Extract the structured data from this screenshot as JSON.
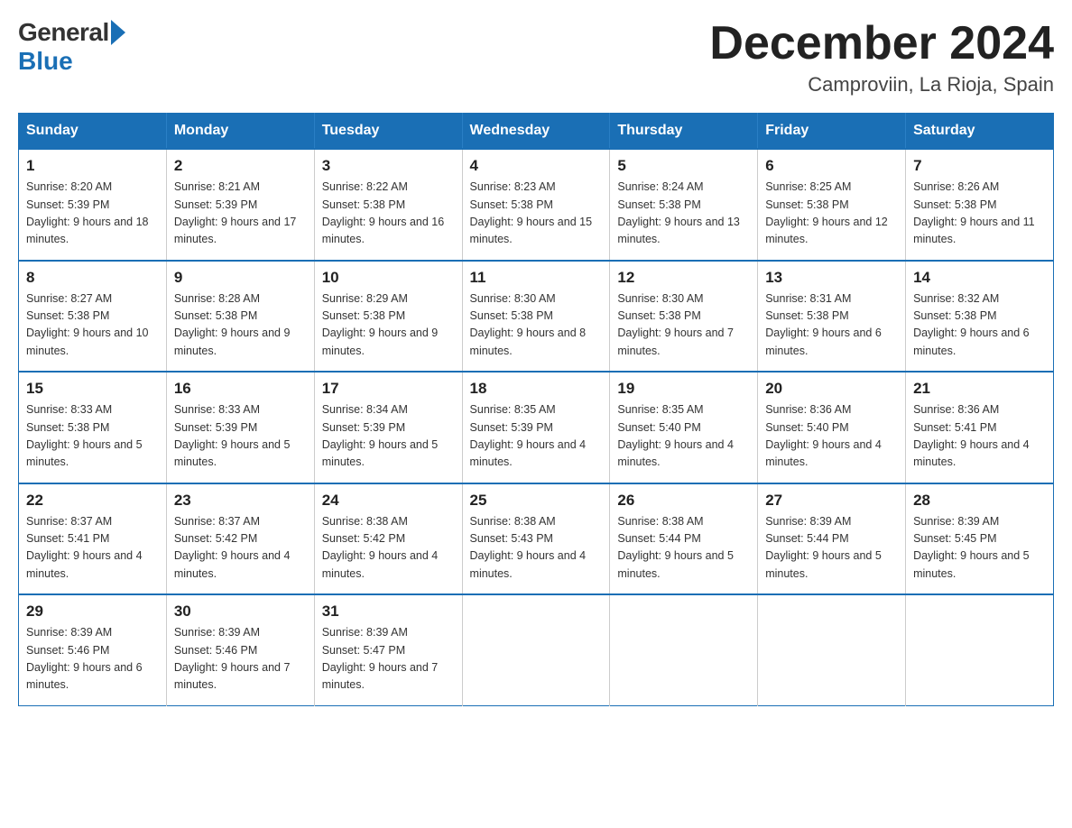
{
  "header": {
    "logo_general": "General",
    "logo_blue": "Blue",
    "month_year": "December 2024",
    "location": "Camproviin, La Rioja, Spain"
  },
  "calendar": {
    "days_of_week": [
      "Sunday",
      "Monday",
      "Tuesday",
      "Wednesday",
      "Thursday",
      "Friday",
      "Saturday"
    ],
    "weeks": [
      [
        {
          "day": "1",
          "sunrise": "8:20 AM",
          "sunset": "5:39 PM",
          "daylight": "9 hours and 18 minutes."
        },
        {
          "day": "2",
          "sunrise": "8:21 AM",
          "sunset": "5:39 PM",
          "daylight": "9 hours and 17 minutes."
        },
        {
          "day": "3",
          "sunrise": "8:22 AM",
          "sunset": "5:38 PM",
          "daylight": "9 hours and 16 minutes."
        },
        {
          "day": "4",
          "sunrise": "8:23 AM",
          "sunset": "5:38 PM",
          "daylight": "9 hours and 15 minutes."
        },
        {
          "day": "5",
          "sunrise": "8:24 AM",
          "sunset": "5:38 PM",
          "daylight": "9 hours and 13 minutes."
        },
        {
          "day": "6",
          "sunrise": "8:25 AM",
          "sunset": "5:38 PM",
          "daylight": "9 hours and 12 minutes."
        },
        {
          "day": "7",
          "sunrise": "8:26 AM",
          "sunset": "5:38 PM",
          "daylight": "9 hours and 11 minutes."
        }
      ],
      [
        {
          "day": "8",
          "sunrise": "8:27 AM",
          "sunset": "5:38 PM",
          "daylight": "9 hours and 10 minutes."
        },
        {
          "day": "9",
          "sunrise": "8:28 AM",
          "sunset": "5:38 PM",
          "daylight": "9 hours and 9 minutes."
        },
        {
          "day": "10",
          "sunrise": "8:29 AM",
          "sunset": "5:38 PM",
          "daylight": "9 hours and 9 minutes."
        },
        {
          "day": "11",
          "sunrise": "8:30 AM",
          "sunset": "5:38 PM",
          "daylight": "9 hours and 8 minutes."
        },
        {
          "day": "12",
          "sunrise": "8:30 AM",
          "sunset": "5:38 PM",
          "daylight": "9 hours and 7 minutes."
        },
        {
          "day": "13",
          "sunrise": "8:31 AM",
          "sunset": "5:38 PM",
          "daylight": "9 hours and 6 minutes."
        },
        {
          "day": "14",
          "sunrise": "8:32 AM",
          "sunset": "5:38 PM",
          "daylight": "9 hours and 6 minutes."
        }
      ],
      [
        {
          "day": "15",
          "sunrise": "8:33 AM",
          "sunset": "5:38 PM",
          "daylight": "9 hours and 5 minutes."
        },
        {
          "day": "16",
          "sunrise": "8:33 AM",
          "sunset": "5:39 PM",
          "daylight": "9 hours and 5 minutes."
        },
        {
          "day": "17",
          "sunrise": "8:34 AM",
          "sunset": "5:39 PM",
          "daylight": "9 hours and 5 minutes."
        },
        {
          "day": "18",
          "sunrise": "8:35 AM",
          "sunset": "5:39 PM",
          "daylight": "9 hours and 4 minutes."
        },
        {
          "day": "19",
          "sunrise": "8:35 AM",
          "sunset": "5:40 PM",
          "daylight": "9 hours and 4 minutes."
        },
        {
          "day": "20",
          "sunrise": "8:36 AM",
          "sunset": "5:40 PM",
          "daylight": "9 hours and 4 minutes."
        },
        {
          "day": "21",
          "sunrise": "8:36 AM",
          "sunset": "5:41 PM",
          "daylight": "9 hours and 4 minutes."
        }
      ],
      [
        {
          "day": "22",
          "sunrise": "8:37 AM",
          "sunset": "5:41 PM",
          "daylight": "9 hours and 4 minutes."
        },
        {
          "day": "23",
          "sunrise": "8:37 AM",
          "sunset": "5:42 PM",
          "daylight": "9 hours and 4 minutes."
        },
        {
          "day": "24",
          "sunrise": "8:38 AM",
          "sunset": "5:42 PM",
          "daylight": "9 hours and 4 minutes."
        },
        {
          "day": "25",
          "sunrise": "8:38 AM",
          "sunset": "5:43 PM",
          "daylight": "9 hours and 4 minutes."
        },
        {
          "day": "26",
          "sunrise": "8:38 AM",
          "sunset": "5:44 PM",
          "daylight": "9 hours and 5 minutes."
        },
        {
          "day": "27",
          "sunrise": "8:39 AM",
          "sunset": "5:44 PM",
          "daylight": "9 hours and 5 minutes."
        },
        {
          "day": "28",
          "sunrise": "8:39 AM",
          "sunset": "5:45 PM",
          "daylight": "9 hours and 5 minutes."
        }
      ],
      [
        {
          "day": "29",
          "sunrise": "8:39 AM",
          "sunset": "5:46 PM",
          "daylight": "9 hours and 6 minutes."
        },
        {
          "day": "30",
          "sunrise": "8:39 AM",
          "sunset": "5:46 PM",
          "daylight": "9 hours and 7 minutes."
        },
        {
          "day": "31",
          "sunrise": "8:39 AM",
          "sunset": "5:47 PM",
          "daylight": "9 hours and 7 minutes."
        },
        null,
        null,
        null,
        null
      ]
    ]
  }
}
